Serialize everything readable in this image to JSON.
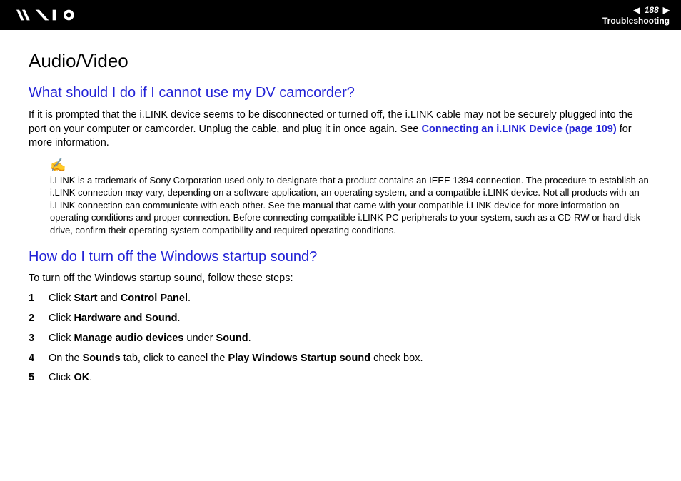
{
  "header": {
    "page_number": "188",
    "section": "Troubleshooting"
  },
  "title": "Audio/Video",
  "q1": {
    "heading": "What should I do if I cannot use my DV camcorder?",
    "para_pre": "If it is prompted that the i.LINK device seems to be disconnected or turned off, the i.LINK cable may not be securely plugged into the port on your computer or camcorder. Unplug the cable, and plug it in once again. See ",
    "link_text": "Connecting an i.LINK Device (page 109)",
    "para_post": " for more information.",
    "note": "i.LINK is a trademark of Sony Corporation used only to designate that a product contains an IEEE 1394 connection. The procedure to establish an i.LINK connection may vary, depending on a software application, an operating system, and a compatible i.LINK device. Not all products with an i.LINK connection can communicate with each other. See the manual that came with your compatible i.LINK device for more information on operating conditions and proper connection. Before connecting compatible i.LINK PC peripherals to your system, such as a CD-RW or hard disk drive, confirm their operating system compatibility and required operating conditions."
  },
  "q2": {
    "heading": "How do I turn off the Windows startup sound?",
    "intro": "To turn off the Windows startup sound, follow these steps:",
    "steps": {
      "s1_pre": "Click ",
      "s1_b1": "Start",
      "s1_mid": " and ",
      "s1_b2": "Control Panel",
      "s1_post": ".",
      "s2_pre": "Click ",
      "s2_b1": "Hardware and Sound",
      "s2_post": ".",
      "s3_pre": "Click ",
      "s3_b1": "Manage audio devices",
      "s3_mid": " under ",
      "s3_b2": "Sound",
      "s3_post": ".",
      "s4_pre": "On the ",
      "s4_b1": "Sounds",
      "s4_mid": " tab, click to cancel the ",
      "s4_b2": "Play Windows Startup sound",
      "s4_post": " check box.",
      "s5_pre": "Click ",
      "s5_b1": "OK",
      "s5_post": "."
    }
  }
}
